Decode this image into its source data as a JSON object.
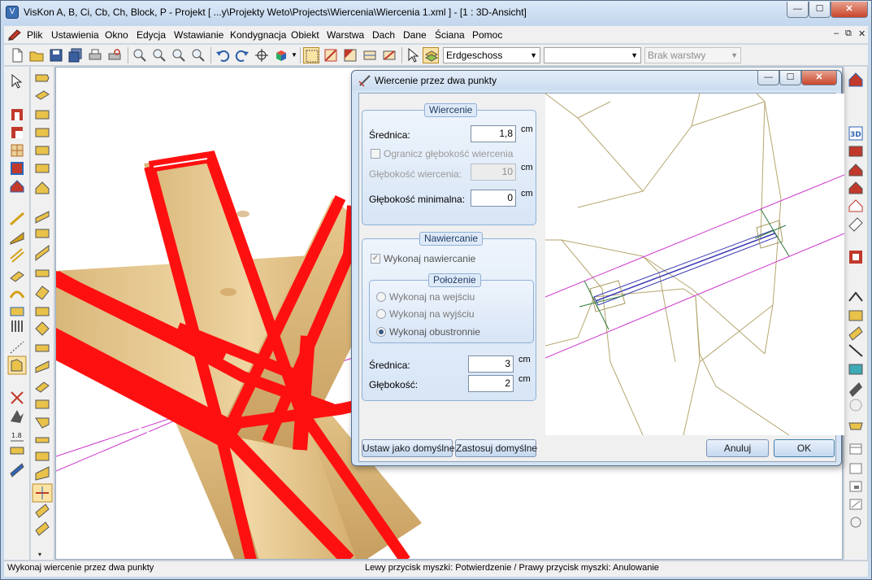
{
  "window": {
    "title": "VisKon A, B, Ci, Cb, Ch, Block, P - Projekt [ ...y\\Projekty Weto\\Projects\\Wiercenia\\Wiercenia 1.xml ]  - [1 : 3D-Ansicht]",
    "controls": {
      "minimize": "—",
      "maximize": "☐",
      "close": "✕"
    }
  },
  "menu": {
    "items": [
      "Plik",
      "Ustawienia",
      "Okno",
      "Edycja",
      "Wstawianie",
      "Kondygnacja",
      "Obiekt",
      "Warstwa",
      "Dach",
      "Dane",
      "Ściana",
      "Pomoc"
    ],
    "mdi": {
      "minimize": "–",
      "restore": "⧉",
      "close": "✕"
    }
  },
  "toolbar": {
    "floor_combo": "Erdgeschoss",
    "second_combo": "",
    "layer_combo": "Brak warstwy"
  },
  "dialog": {
    "title": "Wiercenie przez dwa punkty",
    "group_drilling": {
      "title": "Wiercenie",
      "diameter_label": "Średnica:",
      "diameter_value": "1,8",
      "diameter_unit": "cm",
      "limit_depth_label": "Ogranicz głębokość wiercenia",
      "limit_depth_checked": false,
      "depth_label": "Głębokość wiercenia:",
      "depth_value": "10",
      "depth_unit": "cm",
      "min_depth_label": "Głębokość minimalna:",
      "min_depth_value": "0",
      "min_depth_unit": "cm"
    },
    "group_countersink": {
      "title": "Nawiercanie",
      "execute_label": "Wykonaj nawiercanie",
      "execute_checked": true,
      "position": {
        "title": "Położenie",
        "options": [
          "Wykonaj na wejściu",
          "Wykonaj na wyjściu",
          "Wykonaj obustronnie"
        ],
        "selected_index": 2
      },
      "diameter_label": "Średnica:",
      "diameter_value": "3",
      "diameter_unit": "cm",
      "depth_label": "Głębokość:",
      "depth_value": "2",
      "depth_unit": "cm"
    },
    "buttons": {
      "set_default": "Ustaw jako domyślne",
      "apply_default": "Zastosuj domyślne",
      "cancel": "Anuluj",
      "ok": "OK"
    }
  },
  "status": {
    "left": "Wykonaj wiercenie przez dwa punkty",
    "center": "Lewy przycisk myszki: Potwierdzenie / Prawy przycisk myszki: Anulowanie"
  },
  "colors": {
    "selection_red": "#ff1010",
    "wood_light": "#e9cf98",
    "wood_dark": "#c9a467",
    "magenta_line": "#cc33cc",
    "wire_olive": "#a89a60",
    "drill_blue": "#3b3bb5",
    "drill_green": "#2f7a3d"
  }
}
